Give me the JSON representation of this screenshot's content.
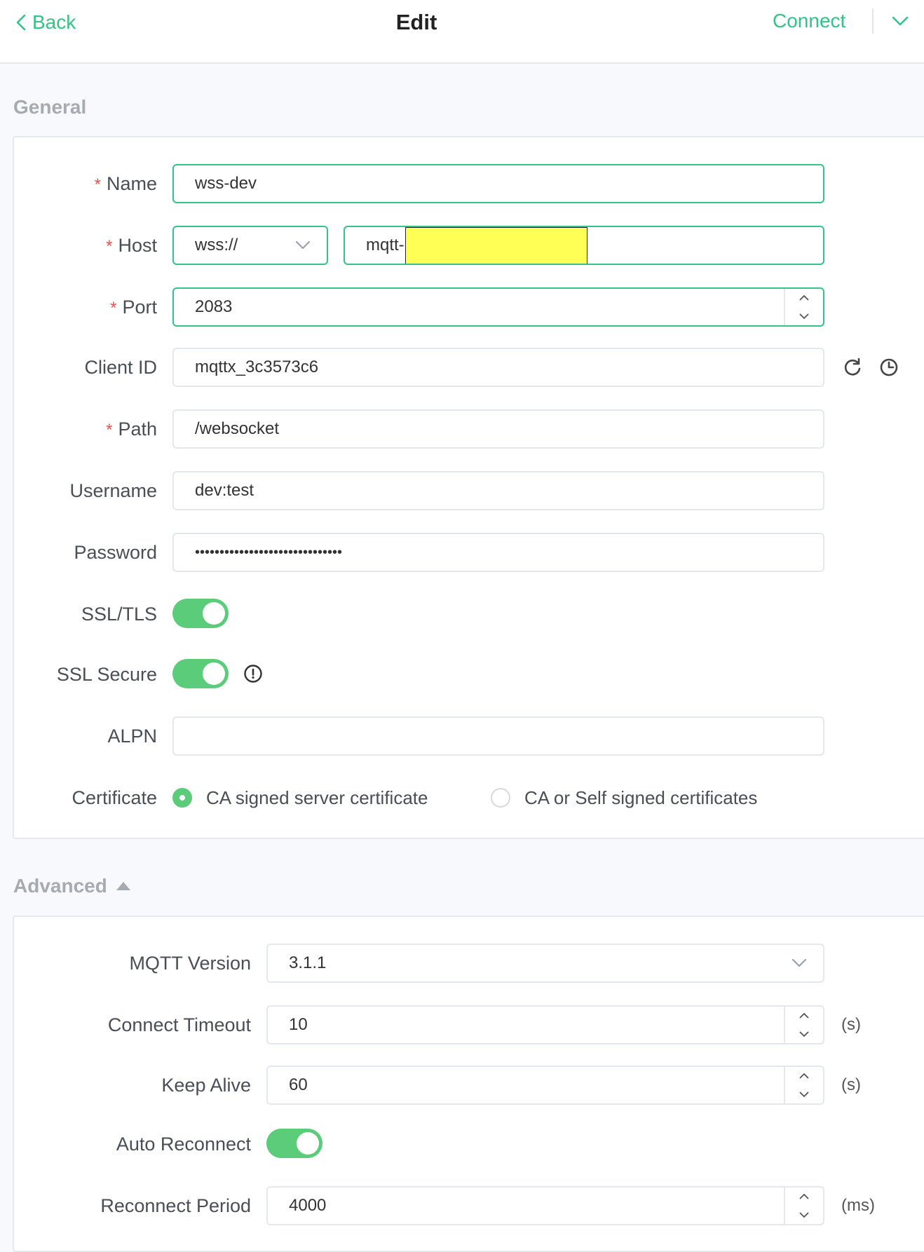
{
  "header": {
    "back_label": "Back",
    "title": "Edit",
    "connect_label": "Connect"
  },
  "general": {
    "section_title": "General",
    "name": {
      "label": "Name",
      "value": "wss-dev",
      "required": true
    },
    "host": {
      "label": "Host",
      "protocol": "wss://",
      "value": "mqtt-",
      "required": true
    },
    "port": {
      "label": "Port",
      "value": "2083",
      "required": true
    },
    "client_id": {
      "label": "Client ID",
      "value": "mqttx_3c3573c6"
    },
    "path": {
      "label": "Path",
      "value": "/websocket",
      "required": true
    },
    "username": {
      "label": "Username",
      "value": "dev:test"
    },
    "password": {
      "label": "Password",
      "value": "••••••••••••••••••••••••••••••"
    },
    "ssl_tls": {
      "label": "SSL/TLS",
      "enabled": true
    },
    "ssl_secure": {
      "label": "SSL Secure",
      "enabled": true
    },
    "alpn": {
      "label": "ALPN",
      "value": ""
    },
    "certificate": {
      "label": "Certificate",
      "options": [
        "CA signed server certificate",
        "CA or Self signed certificates"
      ],
      "selected": "CA signed server certificate"
    }
  },
  "advanced": {
    "section_title": "Advanced",
    "mqtt_version": {
      "label": "MQTT Version",
      "value": "3.1.1"
    },
    "connect_timeout": {
      "label": "Connect Timeout",
      "value": "10",
      "unit": "(s)"
    },
    "keep_alive": {
      "label": "Keep Alive",
      "value": "60",
      "unit": "(s)"
    },
    "auto_reconnect": {
      "label": "Auto Reconnect",
      "enabled": true
    },
    "reconnect_period": {
      "label": "Reconnect Period",
      "value": "4000",
      "unit": "(ms)"
    }
  },
  "colors": {
    "accent": "#34c388",
    "toggle_on": "#5bcc79",
    "required": "#e6544f",
    "redaction": "#ffff55"
  },
  "icons": [
    "chevron-left-icon",
    "chevron-down-icon",
    "refresh-icon",
    "clock-icon",
    "info-circle-icon",
    "caret-up-icon",
    "spin-up-icon",
    "spin-down-icon"
  ]
}
